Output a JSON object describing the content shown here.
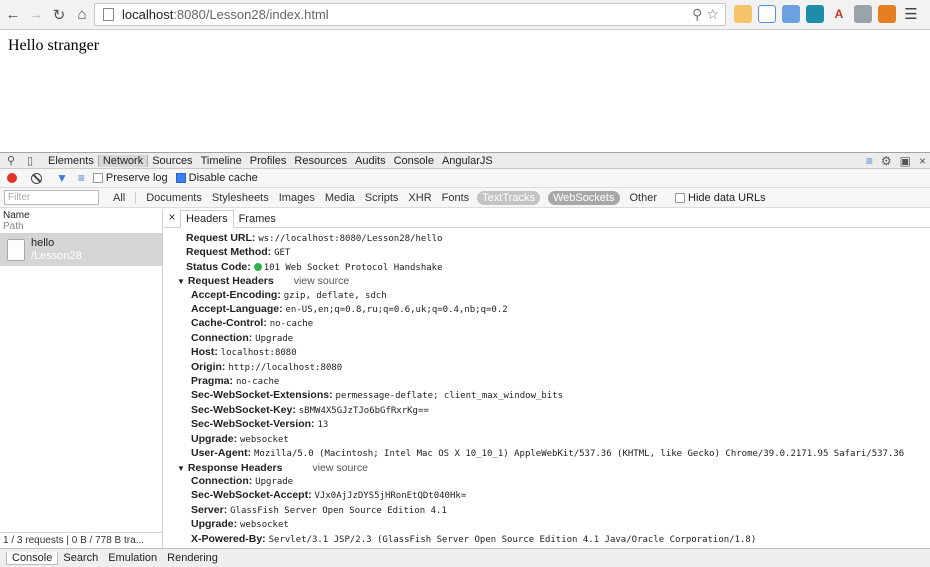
{
  "browser": {
    "url_host": "localhost",
    "url_rest": ":8080/Lesson28/index.html"
  },
  "page": {
    "text": "Hello stranger"
  },
  "devtools": {
    "tabs": [
      "Elements",
      "Network",
      "Sources",
      "Timeline",
      "Profiles",
      "Resources",
      "Audits",
      "Console",
      "AngularJS"
    ],
    "active_tab": "Network",
    "preserve_log": "Preserve log",
    "disable_cache": "Disable cache",
    "filter_placeholder": "Filter",
    "types": [
      "All",
      "Documents",
      "Stylesheets",
      "Images",
      "Media",
      "Scripts",
      "XHR",
      "Fonts",
      "TextTracks",
      "WebSockets",
      "Other"
    ],
    "hide_data_urls": "Hide data URLs",
    "col_name": "Name",
    "col_path": "Path",
    "request": {
      "name": "hello",
      "path": "/Lesson28"
    },
    "summary": "1 / 3 requests | 0 B / 778 B tra...",
    "detail_tabs": [
      "Headers",
      "Frames"
    ],
    "general": [
      {
        "k": "Request URL:",
        "v": "ws://localhost:8080/Lesson28/hello"
      },
      {
        "k": "Request Method:",
        "v": "GET"
      },
      {
        "k": "Status Code:",
        "v": "101 Web Socket Protocol Handshake"
      }
    ],
    "request_headers_title": "Request Headers",
    "view_source": "view source",
    "request_headers": [
      {
        "k": "Accept-Encoding:",
        "v": "gzip, deflate, sdch"
      },
      {
        "k": "Accept-Language:",
        "v": "en-US,en;q=0.8,ru;q=0.6,uk;q=0.4,nb;q=0.2"
      },
      {
        "k": "Cache-Control:",
        "v": "no-cache"
      },
      {
        "k": "Connection:",
        "v": "Upgrade"
      },
      {
        "k": "Host:",
        "v": "localhost:8080"
      },
      {
        "k": "Origin:",
        "v": "http://localhost:8080"
      },
      {
        "k": "Pragma:",
        "v": "no-cache"
      },
      {
        "k": "Sec-WebSocket-Extensions:",
        "v": "permessage-deflate; client_max_window_bits"
      },
      {
        "k": "Sec-WebSocket-Key:",
        "v": "sBMW4X5GJzTJo6bGfRxrKg=="
      },
      {
        "k": "Sec-WebSocket-Version:",
        "v": "13"
      },
      {
        "k": "Upgrade:",
        "v": "websocket"
      },
      {
        "k": "User-Agent:",
        "v": "Mozilla/5.0 (Macintosh; Intel Mac OS X 10_10_1) AppleWebKit/537.36 (KHTML, like Gecko) Chrome/39.0.2171.95 Safari/537.36"
      }
    ],
    "response_headers_title": "Response Headers",
    "response_headers": [
      {
        "k": "Connection:",
        "v": "Upgrade"
      },
      {
        "k": "Sec-WebSocket-Accept:",
        "v": "VJx0AjJzDYS5jHRonEtQDt040Hk="
      },
      {
        "k": "Server:",
        "v": "GlassFish Server Open Source Edition  4.1"
      },
      {
        "k": "Upgrade:",
        "v": "websocket"
      },
      {
        "k": "X-Powered-By:",
        "v": "Servlet/3.1 JSP/2.3 (GlassFish Server Open Source Edition  4.1  Java/Oracle Corporation/1.8)"
      }
    ],
    "drawer_tabs": [
      "Console",
      "Search",
      "Emulation",
      "Rendering"
    ]
  },
  "colors": {
    "status_ok": "#2fb34a",
    "record": "#e0342b",
    "accent": "#3b82f0"
  }
}
